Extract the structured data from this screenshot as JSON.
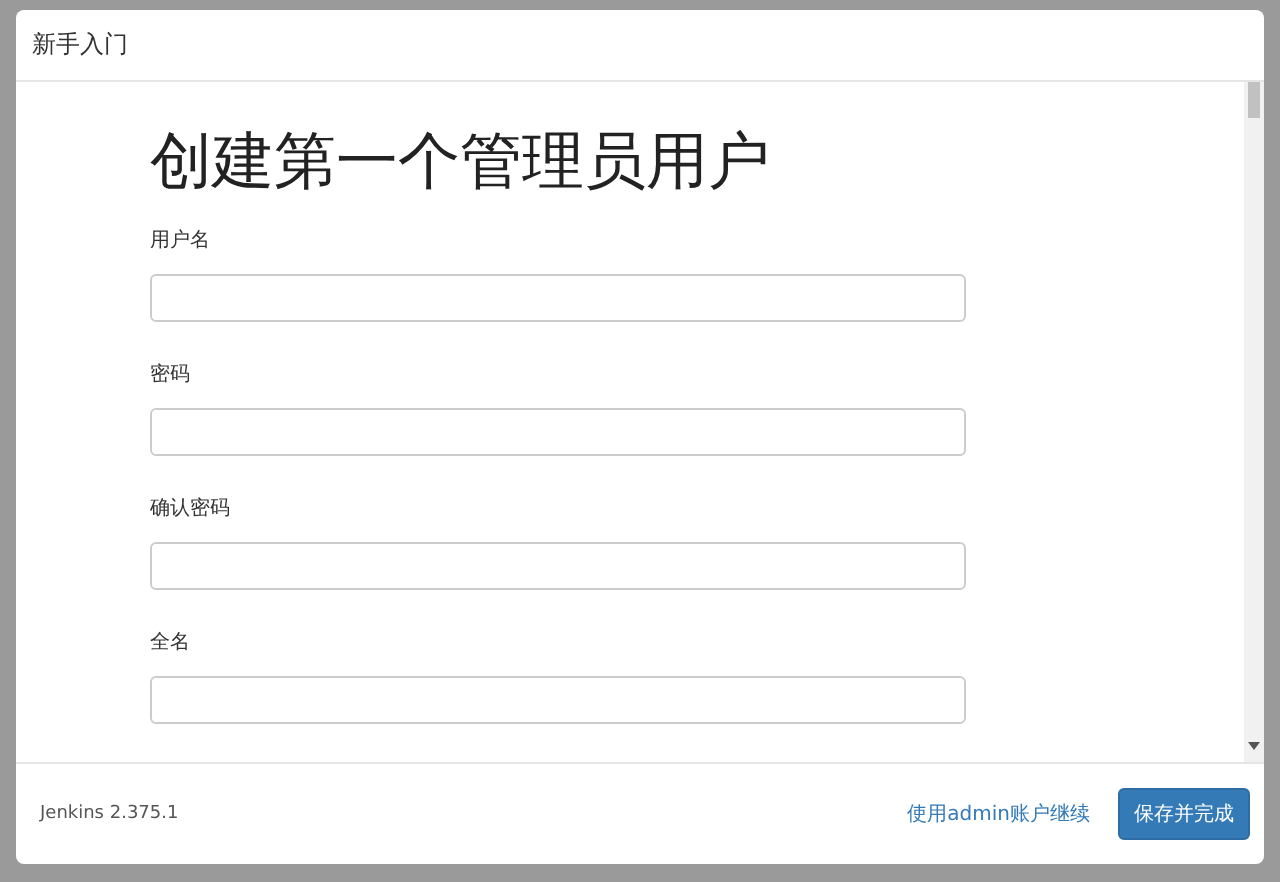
{
  "dialog": {
    "title": "新手入门"
  },
  "heading": "创建第一个管理员用户",
  "fields": [
    {
      "label": "用户名"
    },
    {
      "label": "密码"
    },
    {
      "label": "确认密码"
    },
    {
      "label": "全名"
    }
  ],
  "footer": {
    "version": "Jenkins 2.375.1",
    "link": "使用admin账户继续",
    "button": "保存并完成"
  }
}
